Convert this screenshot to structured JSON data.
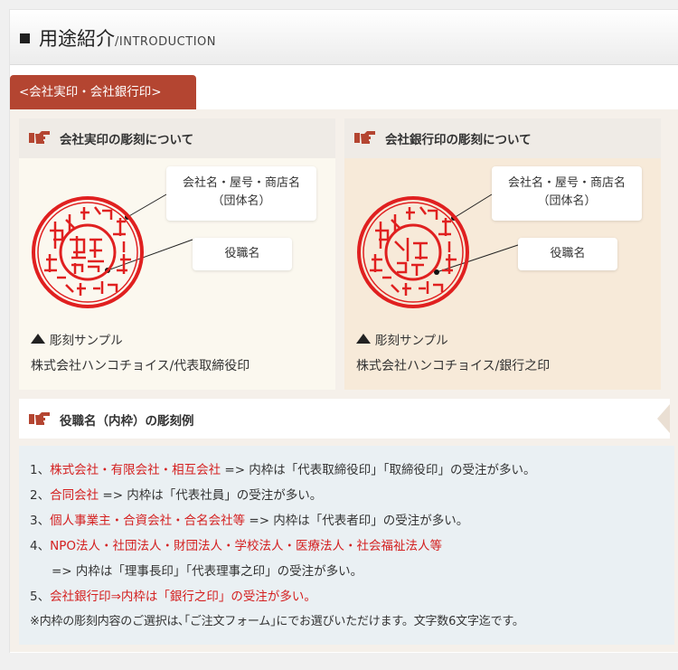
{
  "header": {
    "title": "用途紹介",
    "subtitle": "/INTRODUCTION"
  },
  "tab": {
    "label": "<会社実印・会社銀行印>"
  },
  "cards": [
    {
      "title": "会社実印の彫刻について",
      "callout_outer_line1": "会社名・屋号・商店名",
      "callout_outer_line2": "（団体名）",
      "callout_inner": "役職名",
      "sample_label": "彫刻サンプル",
      "maker": "株式会社ハンコチョイス/代表取締役印"
    },
    {
      "title": "会社銀行印の彫刻について",
      "callout_outer_line1": "会社名・屋号・商店名",
      "callout_outer_line2": "（団体名）",
      "callout_inner": "役職名",
      "sample_label": "彫刻サンプル",
      "maker": "株式会社ハンコチョイス/銀行之印"
    }
  ],
  "examples": {
    "title": "役職名（内枠）の彫刻例",
    "items": [
      {
        "num": "1、",
        "red": "株式会社・有限会社・相互会社",
        "rest": " => 内枠は「代表取締役印」「取締役印」の受注が多い。"
      },
      {
        "num": "2、",
        "red": "合同会社",
        "rest": " => 内枠は「代表社員」の受注が多い。"
      },
      {
        "num": "3、",
        "red": "個人事業主・合資会社・合名会社等",
        "rest": " => 内枠は「代表者印」の受注が多い。"
      },
      {
        "num": "4、",
        "red": "NPO法人・社団法人・財団法人・学校法人・医療法人・社会福祉法人等",
        "rest": ""
      },
      {
        "num": "",
        "red": "",
        "rest": "=> 内枠は「理事長印」「代表理事之印」の受注が多い。"
      },
      {
        "num": "5、",
        "red": "会社銀行印⇒内枠は「銀行之印」の受注が多い。",
        "rest": ""
      }
    ],
    "note": "※内枠の彫刻内容のご選択は､｢ご注文フォーム｣にでお選びいただけます。文字数6文字迄です。"
  },
  "colors": {
    "accent": "#b44531",
    "seal_red": "#e02020",
    "highlight_red": "#d42020"
  },
  "icons": {
    "section_marker": "pointing-hand-icon",
    "sample_marker": "triangle-up-icon"
  }
}
